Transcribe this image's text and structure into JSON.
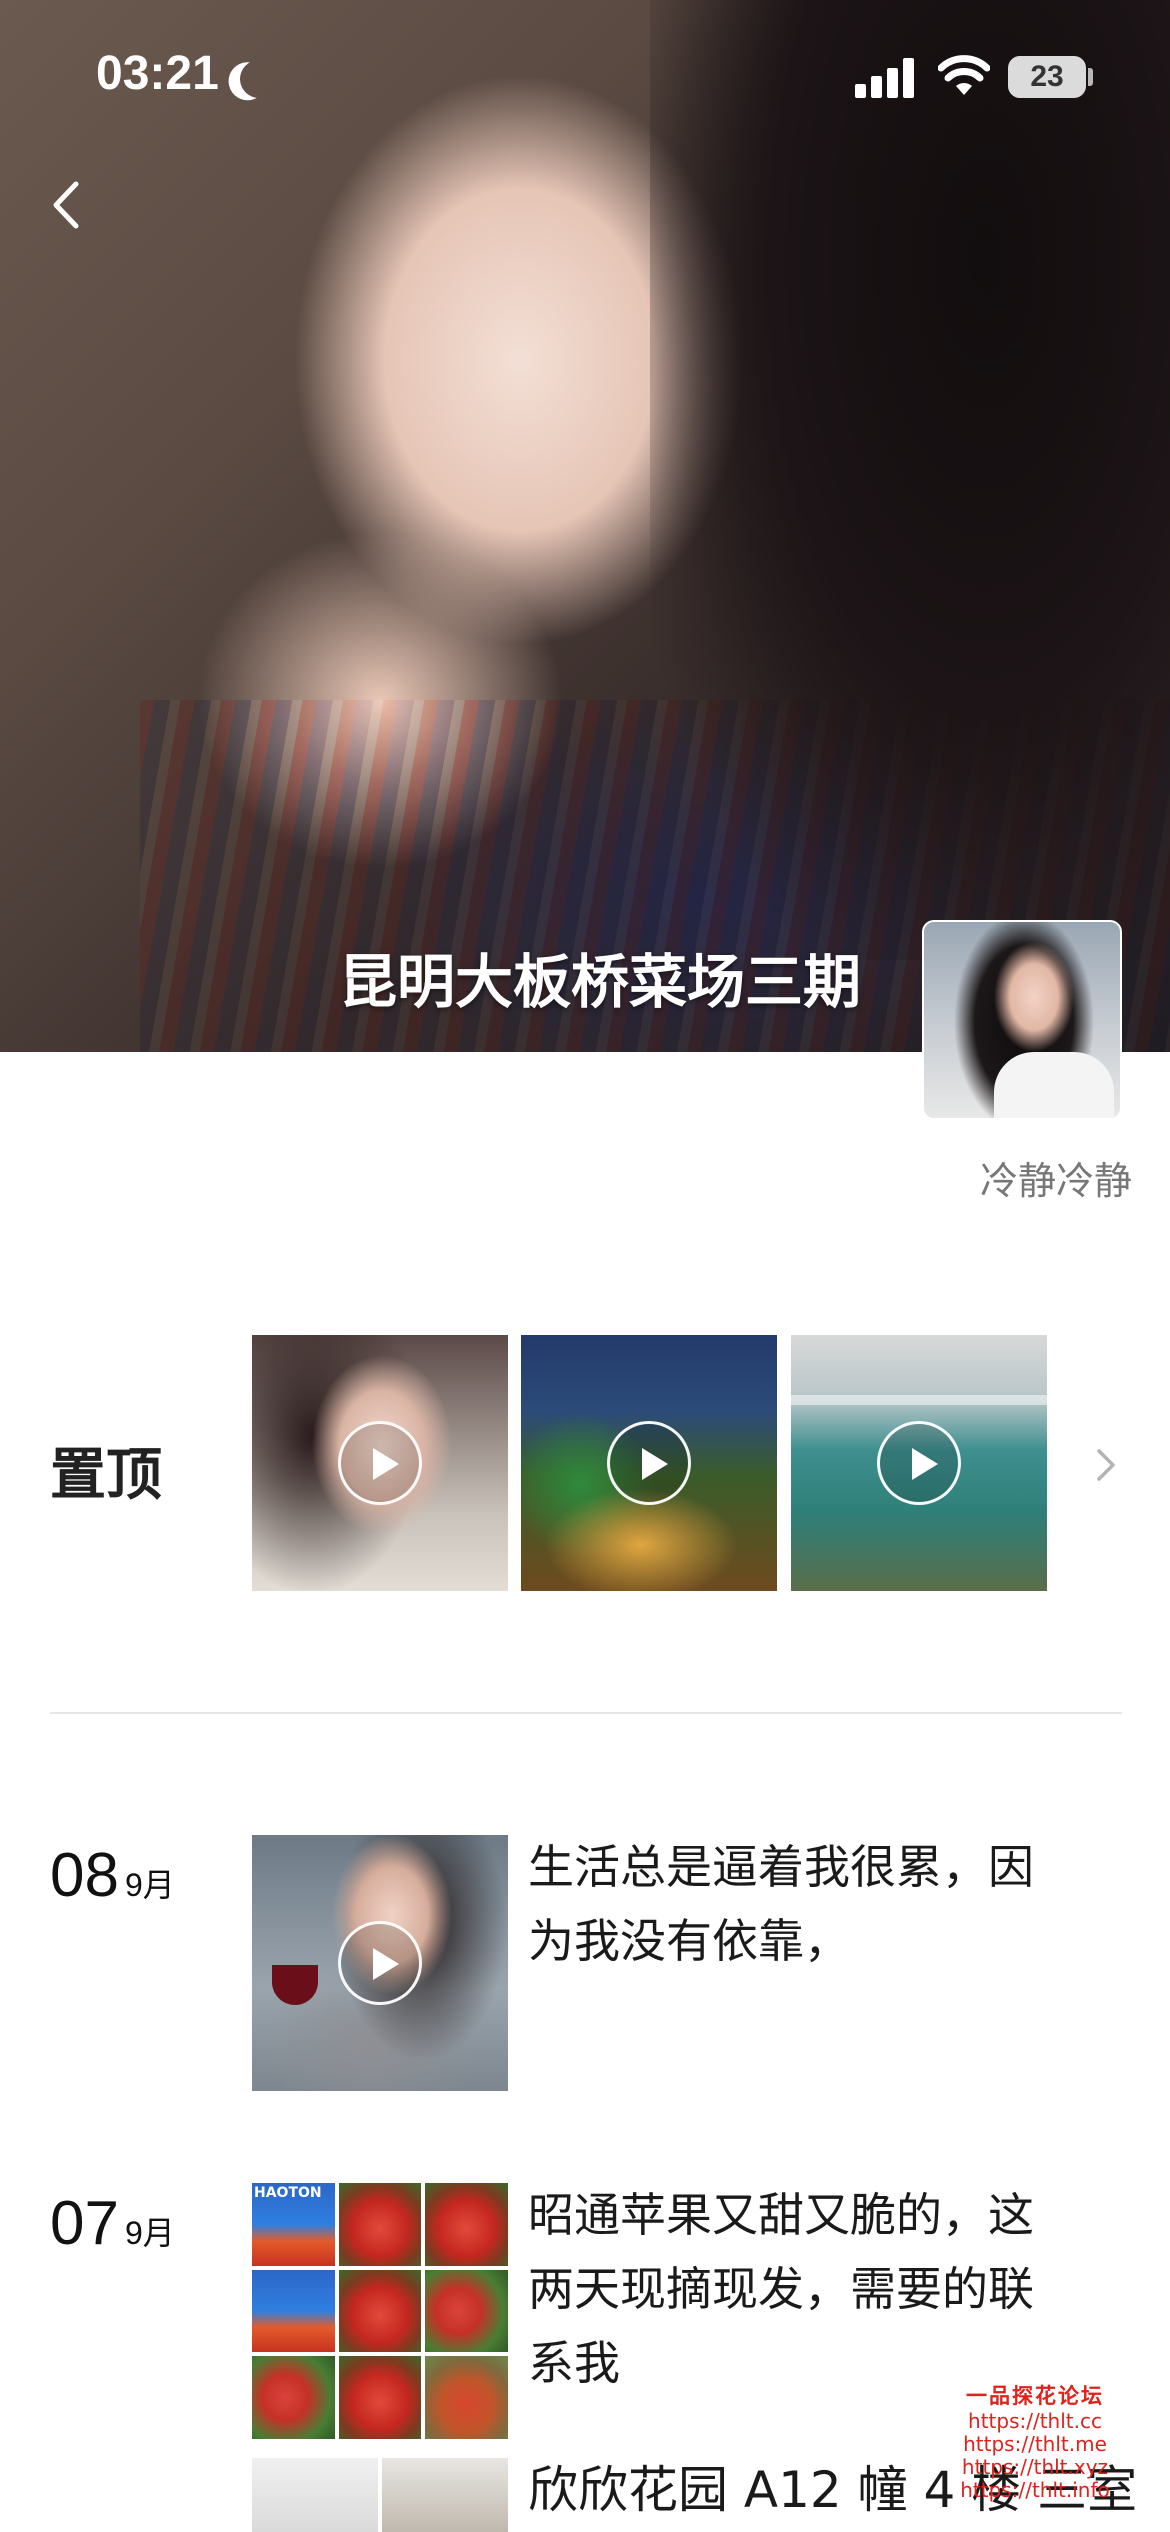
{
  "status_bar": {
    "time": "03:21",
    "battery": "23"
  },
  "cover": {
    "title": "昆明大板桥菜场三期"
  },
  "profile": {
    "nickname": "冷静冷静"
  },
  "pinned": {
    "label": "置顶"
  },
  "posts": [
    {
      "day": "08",
      "month": "9月",
      "text_lines": [
        "生活总是逼着我很累，因",
        "为我没有依靠，"
      ]
    },
    {
      "day": "07",
      "month": "9月",
      "text_lines": [
        "昭通苹果又甜又脆的，这",
        "两天现摘现发，需要的联",
        "系我"
      ],
      "image_text": "HAOTON"
    },
    {
      "text": "欣欣花园 A12 幢 4 楼 三室"
    }
  ],
  "watermark": {
    "title": "一品探花论坛",
    "lines": [
      "https://thlt.cc",
      "https://thlt.me",
      "https://thlt.xyz",
      "https://thlt.info"
    ]
  },
  "colors": {
    "watermark": "#e0221d",
    "divider": "#e6e6e6",
    "nickname": "#777777"
  }
}
